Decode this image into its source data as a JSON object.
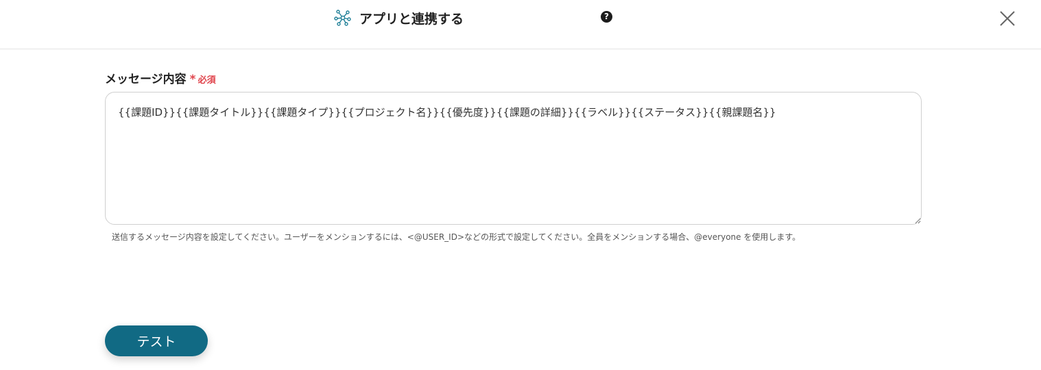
{
  "header": {
    "title": "アプリと連携する",
    "title_icon": "network-nodes-icon",
    "help_icon": "question-circle-icon",
    "help_glyph": "?",
    "close_icon": "close-x-icon"
  },
  "message_field": {
    "label": "メッセージ内容",
    "required_mark": "*",
    "required_text": "必須",
    "value": "{{課題ID}}{{課題タイトル}}{{課題タイプ}}{{プロジェクト名}}{{優先度}}{{課題の詳細}}{{ラベル}}{{ステータス}}{{親課題名}}",
    "helper_text": "送信するメッセージ内容を設定してください。ユーザーをメンションするには、<@USER_ID>などの形式で設定してください。全員をメンションする場合、@everyone を使用します。"
  },
  "actions": {
    "test_label": "テスト"
  },
  "colors": {
    "accent": "#116a84",
    "required": "#e0444c",
    "icon_teal": "#1f7f97"
  }
}
